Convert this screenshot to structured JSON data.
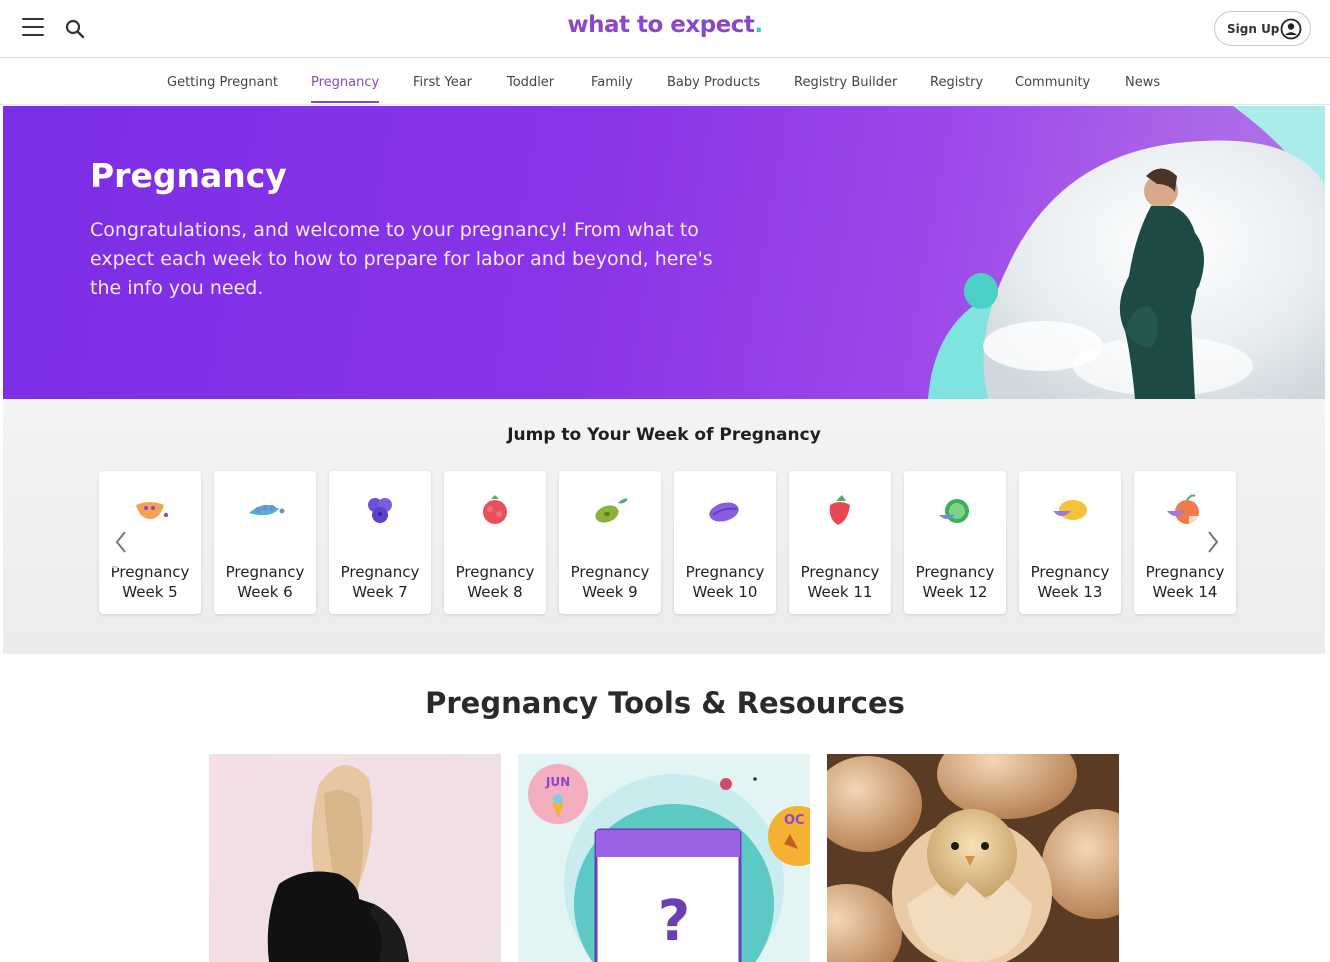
{
  "header": {
    "logo_text": "what to expect",
    "logo_dot": ".",
    "signup_label": "Sign Up",
    "icons": {
      "menu": "hamburger-menu-icon",
      "search": "search-icon",
      "user": "user-circle-icon"
    }
  },
  "nav": {
    "items": [
      {
        "label": "Getting Pregnant"
      },
      {
        "label": "Pregnancy"
      },
      {
        "label": "First Year"
      },
      {
        "label": "Toddler"
      },
      {
        "label": "Family"
      },
      {
        "label": "Baby Products"
      },
      {
        "label": "Registry Builder"
      },
      {
        "label": "Registry"
      },
      {
        "label": "Community"
      },
      {
        "label": "News"
      }
    ],
    "active": "Pregnancy"
  },
  "hero": {
    "title": "Pregnancy",
    "text": "Congratulations, and welcome to your pregnancy! From what to expect each week to how to prepare for labor and beyond, here's the info you need."
  },
  "weeks": {
    "title": "Jump to Your Week of Pregnancy",
    "cards": [
      {
        "line1": "Pregnancy",
        "line2": "Week 5",
        "icon": "orange-seed-icon"
      },
      {
        "line1": "Pregnancy",
        "line2": "Week 6",
        "icon": "pea-pod-icon"
      },
      {
        "line1": "Pregnancy",
        "line2": "Week 7",
        "icon": "blueberry-icon"
      },
      {
        "line1": "Pregnancy",
        "line2": "Week 8",
        "icon": "raspberry-icon"
      },
      {
        "line1": "Pregnancy",
        "line2": "Week 9",
        "icon": "olive-icon"
      },
      {
        "line1": "Pregnancy",
        "line2": "Week 10",
        "icon": "prune-icon"
      },
      {
        "line1": "Pregnancy",
        "line2": "Week 11",
        "icon": "strawberry-icon"
      },
      {
        "line1": "Pregnancy",
        "line2": "Week 12",
        "icon": "lime-icon"
      },
      {
        "line1": "Pregnancy",
        "line2": "Week 13",
        "icon": "lemon-icon"
      },
      {
        "line1": "Pregnancy",
        "line2": "Week 14",
        "icon": "peach-icon"
      }
    ]
  },
  "tools": {
    "title": "Pregnancy Tools & Resources",
    "calendar_badges": {
      "jun": "JUN",
      "oct": "OC",
      "question": "?"
    }
  },
  "colors": {
    "brand": "#8a48c8",
    "teal": "#3cc7c2",
    "hero": "#7b2ee6"
  }
}
